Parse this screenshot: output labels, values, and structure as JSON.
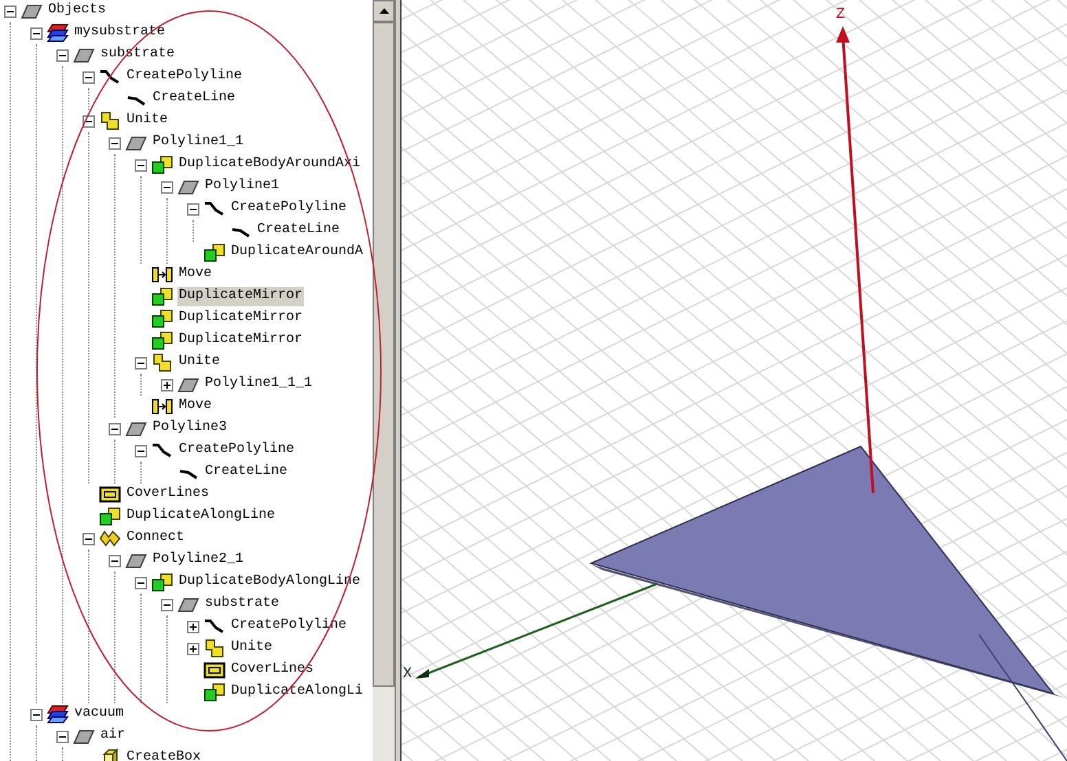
{
  "tree": [
    {
      "label": "Objects",
      "kind": "object",
      "expanded": true,
      "selected": false,
      "children": [
        {
          "label": "mysubstrate",
          "kind": "material",
          "expanded": true,
          "selected": false,
          "children": [
            {
              "label": "substrate",
              "kind": "object",
              "expanded": true,
              "selected": false,
              "children": [
                {
                  "label": "CreatePolyline",
                  "kind": "polyline",
                  "expanded": true,
                  "selected": false,
                  "children": [
                    {
                      "label": "CreateLine",
                      "kind": "line",
                      "selected": false
                    }
                  ]
                },
                {
                  "label": "Unite",
                  "kind": "unite",
                  "expanded": true,
                  "selected": false,
                  "children": [
                    {
                      "label": "Polyline1_1",
                      "kind": "object",
                      "expanded": true,
                      "selected": false,
                      "children": [
                        {
                          "label": "DuplicateBodyAroundAxi",
                          "kind": "duplicate",
                          "expanded": true,
                          "selected": false,
                          "children": [
                            {
                              "label": "Polyline1",
                              "kind": "object",
                              "expanded": true,
                              "selected": false,
                              "children": [
                                {
                                  "label": "CreatePolyline",
                                  "kind": "polyline",
                                  "expanded": true,
                                  "selected": false,
                                  "children": [
                                    {
                                      "label": "CreateLine",
                                      "kind": "line",
                                      "selected": false
                                    }
                                  ]
                                },
                                {
                                  "label": "DuplicateAroundA",
                                  "kind": "duplicate",
                                  "selected": false
                                }
                              ]
                            }
                          ]
                        },
                        {
                          "label": "Move",
                          "kind": "move",
                          "selected": false
                        },
                        {
                          "label": "DuplicateMirror",
                          "kind": "duplicate",
                          "selected": true
                        },
                        {
                          "label": "DuplicateMirror",
                          "kind": "duplicate",
                          "selected": false
                        },
                        {
                          "label": "DuplicateMirror",
                          "kind": "duplicate",
                          "selected": false
                        },
                        {
                          "label": "Unite",
                          "kind": "unite",
                          "expanded": true,
                          "selected": false,
                          "children": [
                            {
                              "label": "Polyline1_1_1",
                              "kind": "object",
                              "expanded": false,
                              "selected": false
                            }
                          ]
                        },
                        {
                          "label": "Move",
                          "kind": "move",
                          "selected": false
                        }
                      ]
                    },
                    {
                      "label": "Polyline3",
                      "kind": "object",
                      "expanded": true,
                      "selected": false,
                      "children": [
                        {
                          "label": "CreatePolyline",
                          "kind": "polyline",
                          "expanded": true,
                          "selected": false,
                          "children": [
                            {
                              "label": "CreateLine",
                              "kind": "line",
                              "selected": false
                            }
                          ]
                        }
                      ]
                    }
                  ]
                },
                {
                  "label": "CoverLines",
                  "kind": "cover",
                  "selected": false
                },
                {
                  "label": "DuplicateAlongLine",
                  "kind": "duplicate",
                  "selected": false
                },
                {
                  "label": "Connect",
                  "kind": "connect",
                  "expanded": true,
                  "selected": false,
                  "children": [
                    {
                      "label": "Polyline2_1",
                      "kind": "object",
                      "expanded": true,
                      "selected": false,
                      "children": [
                        {
                          "label": "DuplicateBodyAlongLine",
                          "kind": "duplicate",
                          "expanded": true,
                          "selected": false,
                          "children": [
                            {
                              "label": "substrate",
                              "kind": "object",
                              "expanded": true,
                              "selected": false,
                              "children": [
                                {
                                  "label": "CreatePolyline",
                                  "kind": "polyline",
                                  "expanded": false,
                                  "selected": false
                                },
                                {
                                  "label": "Unite",
                                  "kind": "unite",
                                  "expanded": false,
                                  "selected": false
                                },
                                {
                                  "label": "CoverLines",
                                  "kind": "cover",
                                  "selected": false
                                },
                                {
                                  "label": "DuplicateAlongLi",
                                  "kind": "duplicate",
                                  "selected": false
                                }
                              ]
                            }
                          ]
                        }
                      ]
                    }
                  ]
                }
              ]
            }
          ]
        },
        {
          "label": "vacuum",
          "kind": "material",
          "expanded": true,
          "selected": false,
          "children": [
            {
              "label": "air",
              "kind": "object",
              "expanded": true,
              "selected": false,
              "children": [
                {
                  "label": "CreateBox",
                  "kind": "box",
                  "selected": false
                }
              ]
            }
          ]
        }
      ]
    }
  ],
  "viewport": {
    "z_axis_label": "Z",
    "x_axis_label": "X"
  }
}
